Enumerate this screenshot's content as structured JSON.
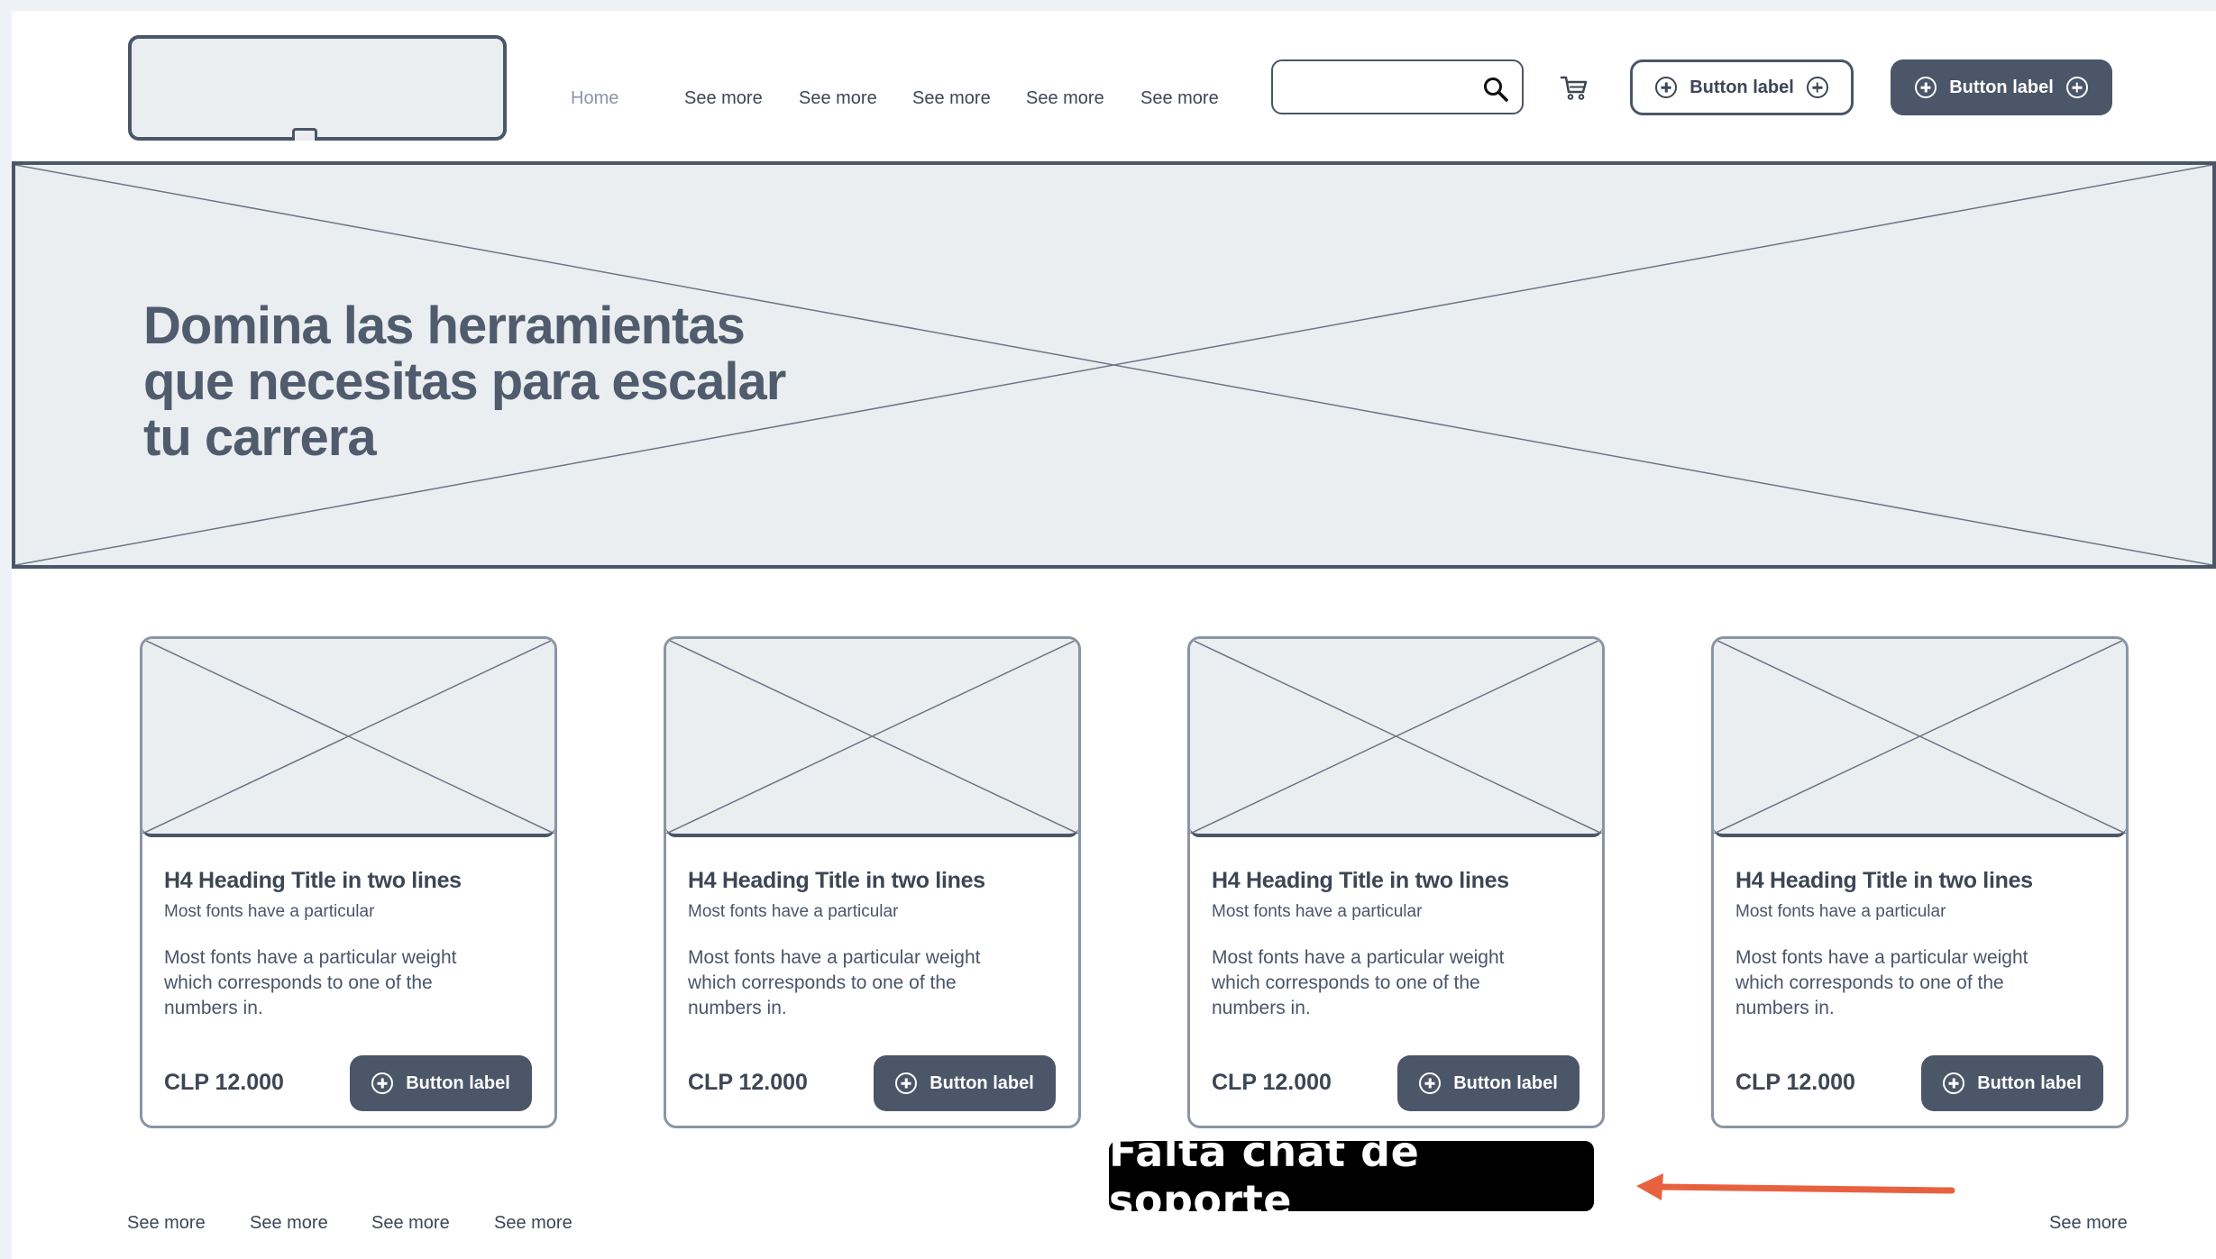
{
  "header": {
    "nav": [
      "Home",
      "See more",
      "See more",
      "See more",
      "See more",
      "See more"
    ],
    "search": {
      "value": "",
      "placeholder": ""
    },
    "outline_button_label": "Button label",
    "primary_button_label": "Button label"
  },
  "hero": {
    "title_lines": [
      "Domina las herramientas",
      "que necesitas para escalar",
      "tu carrera"
    ]
  },
  "cards": [
    {
      "title": "H4 Heading Title in two lines",
      "subtitle": "Most fonts have a particular",
      "body": "Most fonts have a particular weight which corresponds to one of the numbers in.",
      "price": "CLP 12.000",
      "button": "Button label"
    },
    {
      "title": "H4 Heading Title in two lines",
      "subtitle": "Most fonts have a particular",
      "body": "Most fonts have a particular weight which corresponds to one of the numbers in.",
      "price": "CLP 12.000",
      "button": "Button label"
    },
    {
      "title": "H4 Heading Title in two lines",
      "subtitle": "Most fonts have a particular",
      "body": "Most fonts have a particular weight which corresponds to one of the numbers in.",
      "price": "CLP 12.000",
      "button": "Button label"
    },
    {
      "title": "H4 Heading Title in two lines",
      "subtitle": "Most fonts have a particular",
      "body": "Most fonts have a particular weight which corresponds to one of the numbers in.",
      "price": "CLP 12.000",
      "button": "Button label"
    }
  ],
  "footer": {
    "links_left": [
      "See more",
      "See more",
      "See more",
      "See more"
    ],
    "link_right": "See more"
  },
  "annotation": {
    "callout": "Falta chat de soporte",
    "color": "#e8613f"
  },
  "colors": {
    "primary_dark": "#4b5668",
    "placeholder_fill": "#eaeef1",
    "nav_active": "#8a96a6"
  }
}
